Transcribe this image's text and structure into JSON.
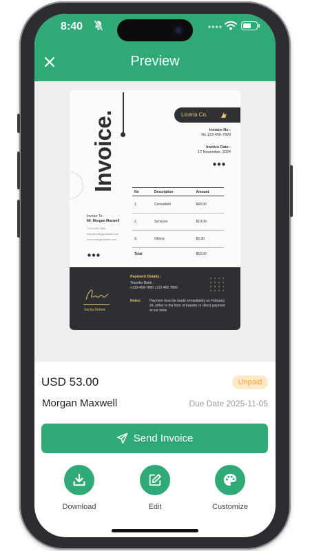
{
  "status_bar": {
    "time": "8:40"
  },
  "header": {
    "title": "Preview"
  },
  "invoice_doc": {
    "heading": "Invoice.",
    "brand": "Liceria Co.",
    "invoice_no_label": "Invoice No :",
    "invoice_no": "No.123-456-7890",
    "invoice_date_label": "Invoice Date :",
    "invoice_date": "17 November, 2024",
    "invoice_to_label": "Invoice To :",
    "recipient_name": "Mr. Morgan Maxwell",
    "recipient_phone": "+123-456-7890",
    "recipient_email": "hello@reallygreatsite.com",
    "recipient_site": "www.reallygreatsite.com",
    "table_headers": [
      "No",
      "Description",
      "Amount"
    ],
    "rows": [
      {
        "no": "1.",
        "description": "Consultant",
        "amount": "$40.00"
      },
      {
        "no": "2.",
        "description": "Services",
        "amount": "$10.00"
      },
      {
        "no": "3.",
        "description": "Others",
        "amount": "$3.00"
      }
    ],
    "total_label": "Total",
    "total_amount": "$53.00",
    "payment_title": "Payment Details:",
    "payment_line1": "Transfer Bank :",
    "payment_line2": "+123-456-7890 | 123 456 7890",
    "notes_label": "Notes:",
    "notes_text": "Payment must be made immediately on February 24, either in the form of transfer or direct payment at our store",
    "signature_name": "Sacha Dubois"
  },
  "summary": {
    "amount": "USD 53.00",
    "status": "Unpaid",
    "client": "Morgan Maxwell",
    "due_date": "Due Date 2025-11-05"
  },
  "actions": {
    "send_label": "Send Invoice",
    "download_label": "Download",
    "edit_label": "Edit",
    "customize_label": "Customize"
  },
  "colors": {
    "accent": "#2faa76",
    "status_bg": "#fde8c8",
    "status_text": "#f0a442",
    "doc_dark": "#2d2f33",
    "doc_gold": "#e7c66b"
  },
  "icons": {
    "close": "close-icon",
    "send": "send-icon",
    "download": "download-icon",
    "edit": "edit-icon",
    "customize": "palette-icon"
  }
}
